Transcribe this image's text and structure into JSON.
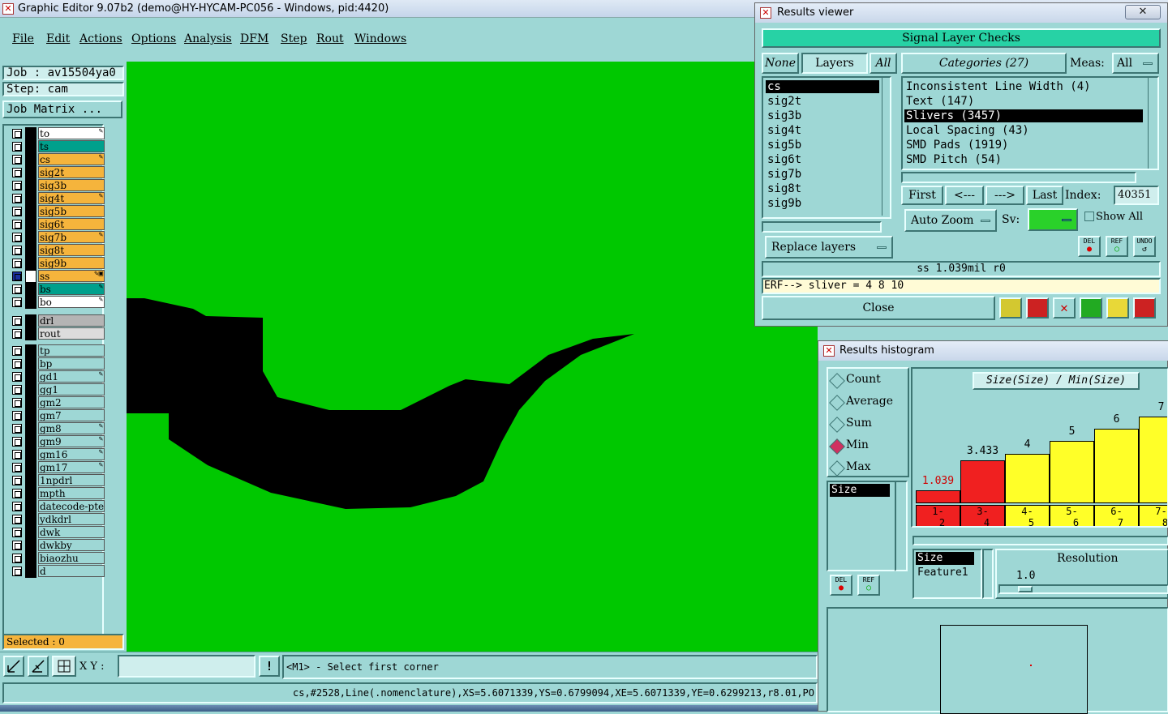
{
  "app": {
    "title": "Graphic Editor 9.07b2 (demo@HY-HYCAM-PC056 - Windows, pid:4420)"
  },
  "menu": [
    "File",
    "Edit",
    "Actions",
    "Options",
    "Analysis",
    "DFM",
    "Step",
    "Rout",
    "Windows"
  ],
  "job": {
    "job_label": "Job : av15504ya0",
    "step_label": "Step: cam",
    "matrix_button": "Job Matrix ..."
  },
  "layers_top": [
    {
      "name": "to",
      "color": "#ffffff",
      "flag": "✎"
    },
    {
      "name": "ts",
      "color": "#00a08c",
      "flag": ""
    },
    {
      "name": "cs",
      "color": "#f5b43c",
      "flag": "✎"
    },
    {
      "name": "sig2t",
      "color": "#f5b43c",
      "flag": ""
    },
    {
      "name": "sig3b",
      "color": "#f5b43c",
      "flag": ""
    },
    {
      "name": "sig4t",
      "color": "#f5b43c",
      "flag": "✎"
    },
    {
      "name": "sig5b",
      "color": "#f5b43c",
      "flag": ""
    },
    {
      "name": "sig6t",
      "color": "#f5b43c",
      "flag": ""
    },
    {
      "name": "sig7b",
      "color": "#f5b43c",
      "flag": "✎"
    },
    {
      "name": "sig8t",
      "color": "#f5b43c",
      "flag": ""
    },
    {
      "name": "sig9b",
      "color": "#f5b43c",
      "flag": ""
    },
    {
      "name": "ss",
      "color": "#f5b43c",
      "flag": "✎▣"
    },
    {
      "name": "bs",
      "color": "#00a08c",
      "flag": "✎"
    },
    {
      "name": "bo",
      "color": "#ffffff",
      "flag": "✎"
    }
  ],
  "layers_drill": [
    {
      "name": "drl",
      "color": "#b4b4b4",
      "flag": ""
    },
    {
      "name": "rout",
      "color": "#dcdcdc",
      "flag": ""
    }
  ],
  "layers_misc": [
    {
      "name": "tp",
      "flag": ""
    },
    {
      "name": "bp",
      "flag": ""
    },
    {
      "name": "gd1",
      "flag": "✎"
    },
    {
      "name": "gg1",
      "flag": ""
    },
    {
      "name": "gm2",
      "flag": ""
    },
    {
      "name": "gm7",
      "flag": ""
    },
    {
      "name": "gm8",
      "flag": "✎"
    },
    {
      "name": "gm9",
      "flag": "✎"
    },
    {
      "name": "gm16",
      "flag": "✎"
    },
    {
      "name": "gm17",
      "flag": "✎"
    },
    {
      "name": "1npdrl",
      "flag": ""
    },
    {
      "name": "mpth",
      "flag": ""
    },
    {
      "name": "datecode-pte",
      "flag": ""
    },
    {
      "name": "ydkdrl",
      "flag": ""
    },
    {
      "name": "dwk",
      "flag": ""
    },
    {
      "name": "dwkby",
      "flag": ""
    },
    {
      "name": "biaozhu",
      "flag": ""
    },
    {
      "name": "d",
      "flag": ""
    }
  ],
  "selected": "Selected : 0",
  "cmd": {
    "xy_label": "X Y :",
    "xy_value": "",
    "prompt": "<M1> - Select first corner"
  },
  "status": "cs,#2528,Line(.nomenclature),XS=5.6071339,YS=0.6799094,XE=5.6071339,YE=0.6299213,r8.01,PO",
  "results_viewer": {
    "title": "Results viewer",
    "close_x": "✕",
    "header": "Signal Layer Checks",
    "tabs": {
      "none": "None",
      "layers": "Layers",
      "all": "All"
    },
    "categories_label": "Categories (27)",
    "meas_label": "Meas:",
    "meas_value": "All",
    "layers": [
      "cs",
      "sig2t",
      "sig3b",
      "sig4t",
      "sig5b",
      "sig6t",
      "sig7b",
      "sig8t",
      "sig9b"
    ],
    "categories": [
      "Inconsistent Line Width (4)",
      "Text (147)",
      "Slivers (3457)",
      "Local Spacing (43)",
      "SMD Pads (1919)",
      "SMD Pitch (54)"
    ],
    "nav": {
      "first": "First",
      "prev": "<---",
      "next": "--->",
      "last": "Last",
      "index_label": "Index:",
      "index_value": "40351"
    },
    "auto_zoom": "Auto Zoom",
    "sv_label": "Sv:",
    "show_all": "Show All",
    "replace_layers": "Replace layers",
    "del": "DEL",
    "ref": "REF",
    "undo": "UNDO",
    "measure_line": "ss 1.039mil  r0",
    "erf_line": "ERF--> sliver = 4 8 10",
    "close_btn": "Close"
  },
  "histogram": {
    "title": "Results histogram",
    "functions": [
      "Count",
      "Average",
      "Sum",
      "Min",
      "Max"
    ],
    "selected_function": "Min",
    "chart_title": "Size(Size) / Min(Size)",
    "attr_list": [
      "Size"
    ],
    "x_list": [
      "Size",
      "Feature1"
    ],
    "resolution_label": "Resolution",
    "resolution_value": "1.0",
    "del": "DEL",
    "ref": "REF"
  },
  "chart_data": {
    "type": "bar",
    "title": "Size(Size) / Min(Size)",
    "categories": [
      [
        "1-",
        "2"
      ],
      [
        "3-",
        "4"
      ],
      [
        "4-",
        "5"
      ],
      [
        "5-",
        "6"
      ],
      [
        "6-",
        "7"
      ],
      [
        "7-",
        "8"
      ]
    ],
    "values": [
      1.039,
      3.433,
      4,
      5,
      6,
      7
    ],
    "labels": [
      "1.039",
      "3.433",
      "4",
      "5",
      "6",
      "7"
    ],
    "colors": [
      "#f02020",
      "#f02020",
      "#ffff28",
      "#ffff28",
      "#ffff28",
      "#ffff28"
    ],
    "label_colors": [
      "#d00000",
      "#000000",
      "#000000",
      "#000000",
      "#000000",
      "#000000"
    ]
  }
}
